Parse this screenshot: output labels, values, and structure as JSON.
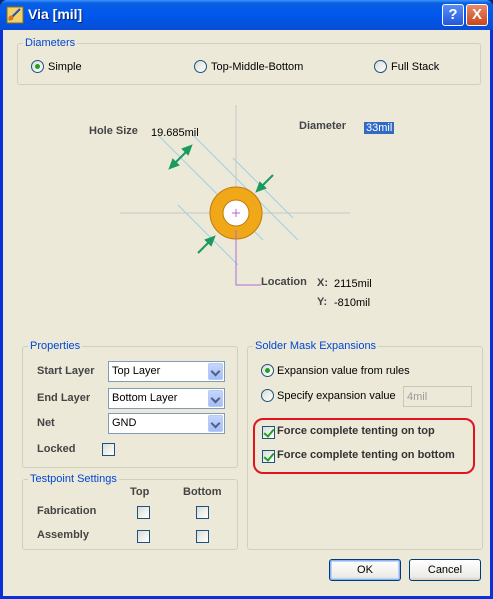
{
  "window": {
    "title": "Via [mil]",
    "help_label": "?",
    "close_label": "X"
  },
  "diameters": {
    "legend": "Diameters",
    "options": [
      {
        "label": "Simple",
        "selected": true
      },
      {
        "label": "Top-Middle-Bottom",
        "selected": false
      },
      {
        "label": "Full Stack",
        "selected": false
      }
    ]
  },
  "diagram": {
    "hole_size_label": "Hole Size",
    "hole_size_value": "19.685mil",
    "diameter_label": "Diameter",
    "diameter_value": "33mil",
    "location_label": "Location",
    "x_label": "X:",
    "x_value": "2115mil",
    "y_label": "Y:",
    "y_value": "-810mil"
  },
  "properties": {
    "legend": "Properties",
    "start_layer_label": "Start Layer",
    "start_layer_value": "Top Layer",
    "end_layer_label": "End Layer",
    "end_layer_value": "Bottom Layer",
    "net_label": "Net",
    "net_value": "GND",
    "locked_label": "Locked",
    "locked": false
  },
  "testpoint": {
    "legend": "Testpoint Settings",
    "col_top": "Top",
    "col_bottom": "Bottom",
    "rows": [
      {
        "label": "Fabrication",
        "top": false,
        "bottom": false
      },
      {
        "label": "Assembly",
        "top": false,
        "bottom": false
      }
    ]
  },
  "solder_mask": {
    "legend": "Solder Mask Expansions",
    "from_rules_label": "Expansion value from rules",
    "from_rules_selected": true,
    "specify_label": "Specify expansion value",
    "specify_value": "4mil",
    "tent_top_label": "Force complete tenting on top",
    "tent_top": true,
    "tent_bottom_label": "Force complete tenting on bottom",
    "tent_bottom": true
  },
  "buttons": {
    "ok": "OK",
    "cancel": "Cancel"
  },
  "colors": {
    "ring": "#f0a818",
    "accent_title": "#0046d5",
    "highlight": "#e0141e"
  }
}
